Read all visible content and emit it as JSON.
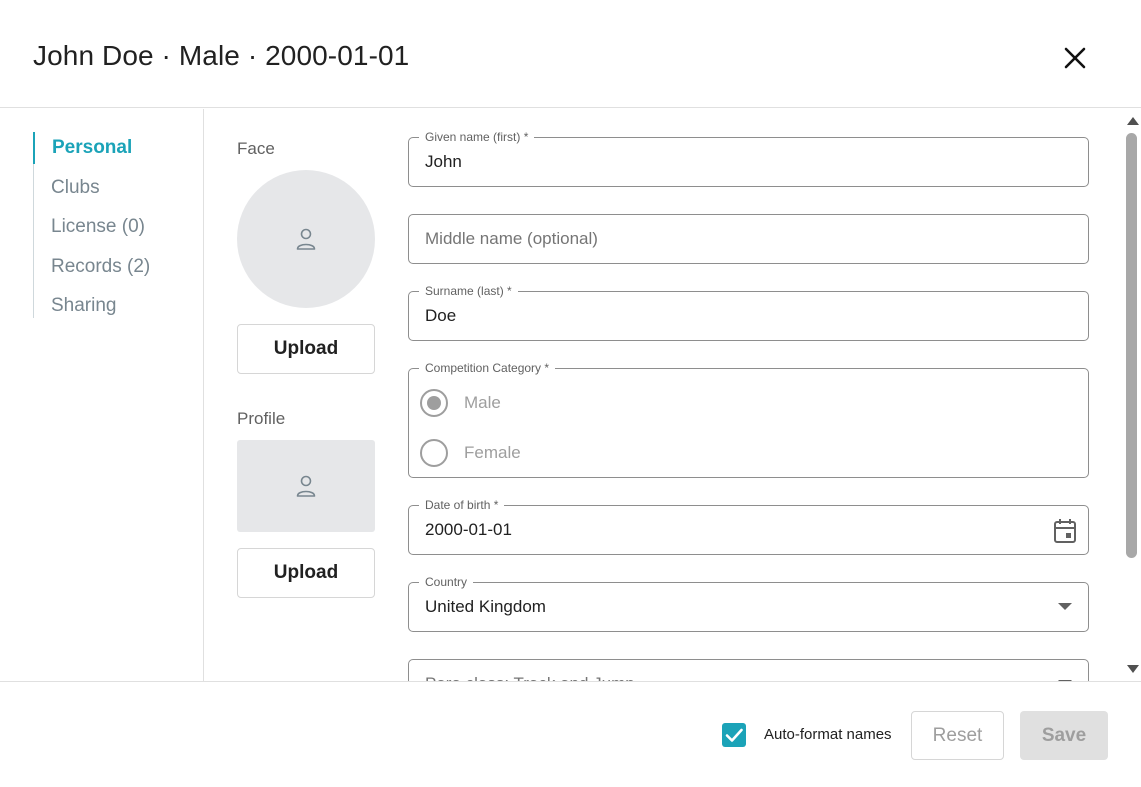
{
  "header": {
    "title": "John Doe · Male · 2000-01-01"
  },
  "sidebar": {
    "items": [
      {
        "label": "Personal",
        "active": true
      },
      {
        "label": "Clubs",
        "active": false
      },
      {
        "label": "License (0)",
        "active": false
      },
      {
        "label": "Records (2)",
        "active": false
      },
      {
        "label": "Sharing",
        "active": false
      }
    ]
  },
  "images": {
    "face_label": "Face",
    "profile_label": "Profile",
    "face_upload_label": "Upload",
    "profile_upload_label": "Upload"
  },
  "form": {
    "given_name": {
      "label": "Given name (first) *",
      "value": "John"
    },
    "middle_name": {
      "placeholder": "Middle name (optional)"
    },
    "surname": {
      "label": "Surname (last) *",
      "value": "Doe"
    },
    "category": {
      "label": "Competition Category  *",
      "options": [
        {
          "label": "Male",
          "checked": true
        },
        {
          "label": "Female",
          "checked": false
        }
      ]
    },
    "dob": {
      "label": "Date of birth *",
      "value": "2000-01-01"
    },
    "country": {
      "label": "Country",
      "value": "United Kingdom"
    },
    "para_class": {
      "placeholder": "Para class: Track and Jump"
    }
  },
  "footer": {
    "auto_format_label": "Auto-format names",
    "auto_format_checked": true,
    "reset_label": "Reset",
    "save_label": "Save"
  },
  "colors": {
    "accent": "#1ba3b8",
    "disabled_button": "#e0e0e0",
    "placeholder_bg": "#e6e7e9"
  }
}
